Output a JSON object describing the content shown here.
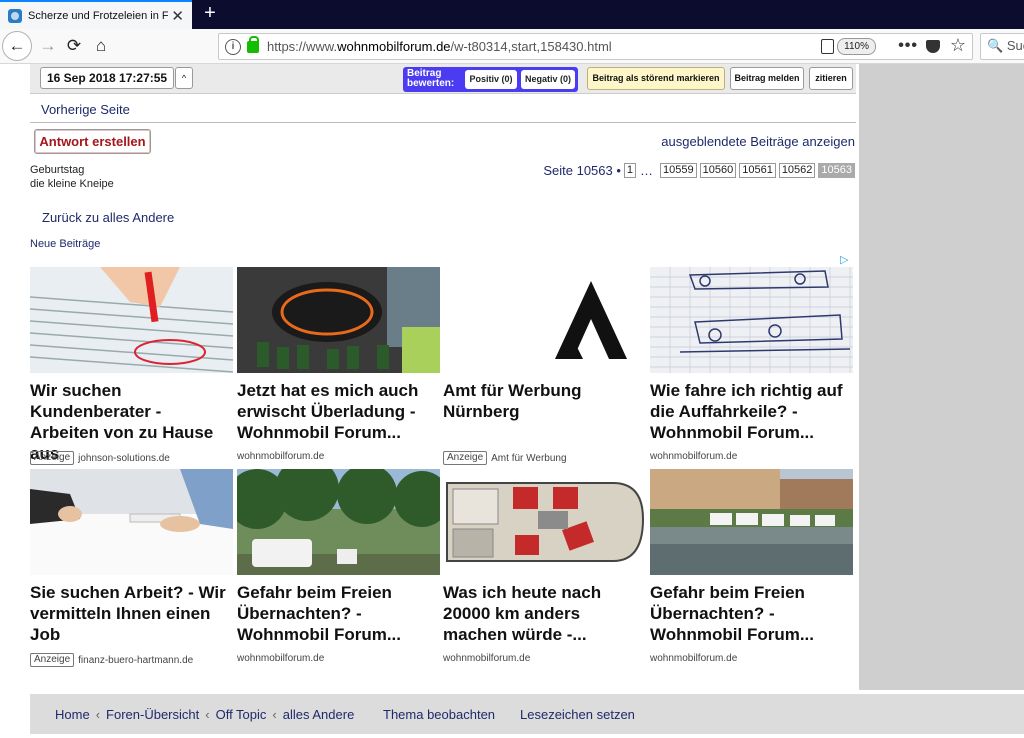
{
  "browser": {
    "tab_title": "Scherze und Frotzeleien in Foren",
    "url_host": "https://www.",
    "url_domain": "wohnmobilforum.de",
    "url_path": "/w-t80314,start,158430.html",
    "zoom": "110%",
    "search_placeholder": "Suc"
  },
  "postbar": {
    "date": "16 Sep 2018 17:27:55",
    "caret": "^",
    "rate_label_1": "Beitrag",
    "rate_label_2": "bewerten:",
    "positive": "Positiv (0)",
    "negative": "Negativ (0)",
    "mark_disturbing": "Beitrag als störend markieren",
    "report": "Beitrag melden",
    "quote": "zitieren"
  },
  "nav": {
    "prev_page": "Vorherige Seite",
    "answer": "Antwort erstellen",
    "show_hidden": "ausgeblendete Beiträge anzeigen",
    "prev_topic": "Geburtstag",
    "next_topic": "die kleine Kneipe",
    "page_label": "Seite 10563 •",
    "pages": [
      "1",
      "…",
      "10559",
      "10560",
      "10561",
      "10562",
      "10563"
    ],
    "back_to": "Zurück zu alles Andere",
    "new_posts": "Neue Beiträge"
  },
  "ads": [
    {
      "headline": "Wir suchen Kundenberater - Arbeiten von zu Hause aus",
      "badge": "Anzeige",
      "source": "johnson-solutions.de"
    },
    {
      "headline": "Jetzt hat es mich auch erwischt Überladung - Wohnmobil Forum...",
      "badge": "",
      "source": "wohnmobilforum.de"
    },
    {
      "headline": "Amt für Werbung Nürnberg",
      "badge": "Anzeige",
      "source": "Amt für Werbung"
    },
    {
      "headline": "Wie fahre ich richtig auf die Auffahrkeile? - Wohnmobil Forum...",
      "badge": "",
      "source": "wohnmobilforum.de"
    },
    {
      "headline": "Sie suchen Arbeit? - Wir vermitteln Ihnen einen Job",
      "badge": "Anzeige",
      "source": "finanz-buero-hartmann.de"
    },
    {
      "headline": "Gefahr beim Freien Übernachten? - Wohnmobil Forum...",
      "badge": "",
      "source": "wohnmobilforum.de"
    },
    {
      "headline": "Was ich heute nach 20000 km anders machen würde -...",
      "badge": "",
      "source": "wohnmobilforum.de"
    },
    {
      "headline": "Gefahr beim Freien Übernachten? - Wohnmobil Forum...",
      "badge": "",
      "source": "wohnmobilforum.de"
    }
  ],
  "footer": {
    "crumbs": [
      "Home",
      "Foren-Übersicht",
      "Off Topic",
      "alles Andere"
    ],
    "sep": "‹",
    "watch": "Thema beobachten",
    "bookmark": "Lesezeichen setzen"
  }
}
